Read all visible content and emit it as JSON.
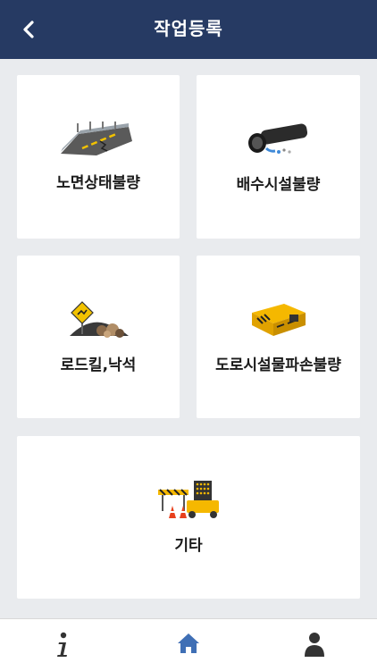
{
  "header": {
    "title": "작업등록",
    "back_icon": "chevron-left-icon"
  },
  "categories": [
    {
      "label": "노면상태불량",
      "icon": "road-surface-icon"
    },
    {
      "label": "배수시설불량",
      "icon": "drain-pipe-icon"
    },
    {
      "label": "로드킬,낙석",
      "icon": "roadkill-rockfall-icon"
    },
    {
      "label": "도로시설물파손불량",
      "icon": "road-facility-icon"
    },
    {
      "label": "기타",
      "icon": "construction-barrier-icon"
    }
  ],
  "tabbar": {
    "items": [
      {
        "icon": "info-icon",
        "active": false
      },
      {
        "icon": "home-icon",
        "active": true
      },
      {
        "icon": "person-icon",
        "active": false
      }
    ],
    "active_color": "#3f6fb5",
    "inactive_color": "#333333"
  },
  "colors": {
    "header_bg": "#263a63",
    "page_bg": "#e9ebee",
    "card_bg": "#ffffff"
  }
}
